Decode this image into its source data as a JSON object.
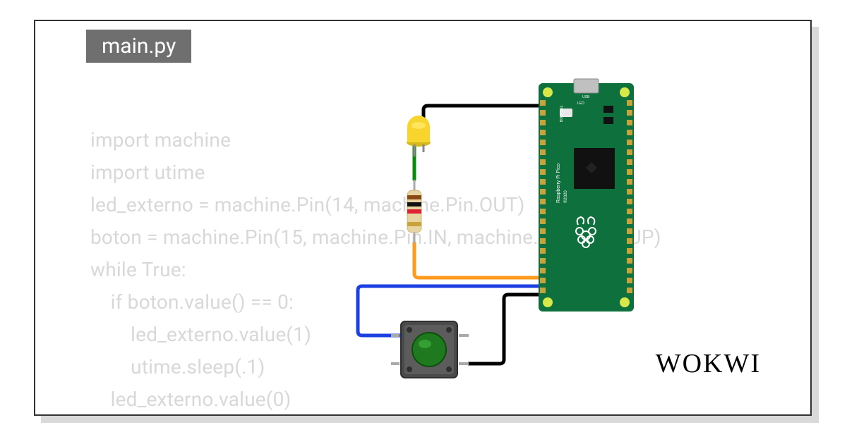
{
  "filename": "main.py",
  "brand": "WOKWI",
  "code": {
    "l1": "import machine",
    "l2": "import utime",
    "l3": "led_externo = machine.Pin(14, machine.Pin.OUT)",
    "l4": "boton = machine.Pin(15, machine.Pin.IN, machine.Pin.PULL_UP)",
    "l5": "while True:",
    "l6": "    if boton.value() == 0:",
    "l7": "        led_externo.value(1)",
    "l8": "        utime.sleep(.1)",
    "l9": "    led_externo.value(0)"
  },
  "components": {
    "board": "Raspberry Pi Pico",
    "led": {
      "color": "#f8d52c",
      "name": "yellow LED"
    },
    "resistor": "resistor (4-band)",
    "button": {
      "color": "#1f7a1f",
      "name": "push button"
    }
  },
  "wires": [
    {
      "id": "black-gnd",
      "from": "pico-gnd",
      "to": "led-cathode",
      "color": "black"
    },
    {
      "id": "green-led",
      "from": "led-anode",
      "to": "resistor-top",
      "color": "green"
    },
    {
      "id": "orange-gp14",
      "from": "resistor-bottom",
      "to": "pico-gp14",
      "color": "orange"
    },
    {
      "id": "blue-gp15",
      "from": "button-tl",
      "to": "pico-gp15",
      "color": "blue"
    },
    {
      "id": "black-btn",
      "from": "button-br",
      "to": "pico-gnd2",
      "color": "black"
    }
  ]
}
